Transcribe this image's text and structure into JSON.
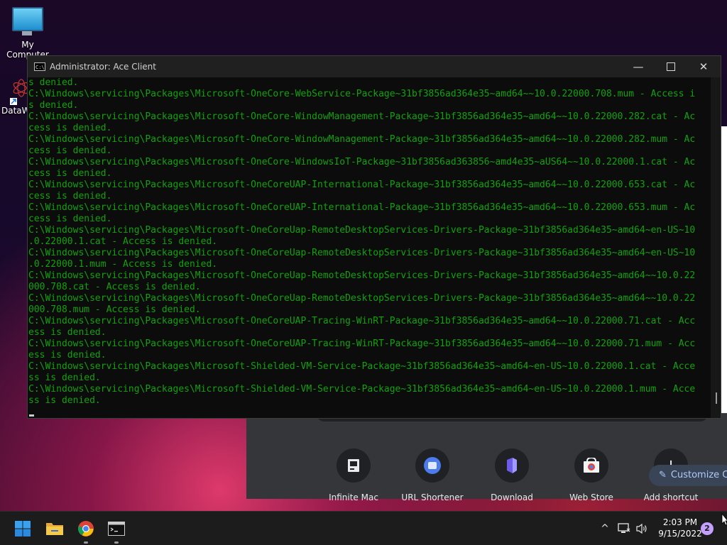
{
  "desktop": {
    "icons": [
      {
        "label": "My Computer",
        "icon": "monitor-icon"
      },
      {
        "label": "DataW",
        "icon": "datawrapper-shortcut-icon"
      }
    ]
  },
  "console_window": {
    "title": "Administrator:  Ace Client",
    "controls": [
      "minimize",
      "maximize",
      "close"
    ],
    "text_color": "#13a10e",
    "lines": [
      "s denied.",
      "C:\\Windows\\servicing\\Packages\\Microsoft-OneCore-WebService-Package~31bf3856ad364e35~amd64~~10.0.22000.708.mum - Access i",
      "s denied.",
      "C:\\Windows\\servicing\\Packages\\Microsoft-OneCore-WindowManagement-Package~31bf3856ad364e35~amd64~~10.0.22000.282.cat - Ac",
      "cess is denied.",
      "C:\\Windows\\servicing\\Packages\\Microsoft-OneCore-WindowManagement-Package~31bf3856ad364e35~amd64~~10.0.22000.282.mum - Ac",
      "cess is denied.",
      "C:\\Windows\\servicing\\Packages\\Microsoft-OneCore-WindowsIoT-Package~31bf3856ad363856~amd4e35~aUS64~~10.0.22000.1.cat - Ac",
      "cess is denied.",
      "C:\\Windows\\servicing\\Packages\\Microsoft-OneCoreUAP-International-Package~31bf3856ad364e35~amd64~~10.0.22000.653.cat - Ac",
      "cess is denied.",
      "C:\\Windows\\servicing\\Packages\\Microsoft-OneCoreUAP-International-Package~31bf3856ad364e35~amd64~~10.0.22000.653.mum - Ac",
      "cess is denied.",
      "C:\\Windows\\servicing\\Packages\\Microsoft-OneCoreUap-RemoteDesktopServices-Drivers-Package~31bf3856ad364e35~amd64~en-US~10",
      ".0.22000.1.cat - Access is denied.",
      "C:\\Windows\\servicing\\Packages\\Microsoft-OneCoreUap-RemoteDesktopServices-Drivers-Package~31bf3856ad364e35~amd64~en-US~10",
      ".0.22000.1.mum - Access is denied.",
      "C:\\Windows\\servicing\\Packages\\Microsoft-OneCoreUap-RemoteDesktopServices-Drivers-Package~31bf3856ad364e35~amd64~~10.0.22",
      "000.708.cat - Access is denied.",
      "C:\\Windows\\servicing\\Packages\\Microsoft-OneCoreUap-RemoteDesktopServices-Drivers-Package~31bf3856ad364e35~amd64~~10.0.22",
      "000.708.mum - Access is denied.",
      "C:\\Windows\\servicing\\Packages\\Microsoft-OneCoreUAP-Tracing-WinRT-Package~31bf3856ad364e35~amd64~~10.0.22000.71.cat - Acc",
      "ess is denied.",
      "C:\\Windows\\servicing\\Packages\\Microsoft-OneCoreUAP-Tracing-WinRT-Package~31bf3856ad364e35~amd64~~10.0.22000.71.mum - Acc",
      "ess is denied.",
      "C:\\Windows\\servicing\\Packages\\Microsoft-Shielded-VM-Service-Package~31bf3856ad364e35~amd64~en-US~10.0.22000.1.cat - Acce",
      "ss is denied.",
      "C:\\Windows\\servicing\\Packages\\Microsoft-Shielded-VM-Service-Package~31bf3856ad364e35~amd64~en-US~10.0.22000.1.mum - Acce",
      "ss is denied."
    ]
  },
  "browser_newtab": {
    "shortcuts": [
      {
        "label": "Infinite Mac",
        "icon": "infinite-mac-icon"
      },
      {
        "label": "URL Shortener",
        "icon": "url-shortener-icon"
      },
      {
        "label": "Download",
        "icon": "download-app-icon"
      },
      {
        "label": "Web Store",
        "icon": "web-store-icon"
      },
      {
        "label": "Add shortcut",
        "icon": "plus-icon"
      }
    ],
    "customize_label": "Customize C"
  },
  "taskbar": {
    "apps": [
      {
        "name": "start",
        "icon": "windows-start-icon"
      },
      {
        "name": "file-explorer",
        "icon": "folder-icon"
      },
      {
        "name": "chrome",
        "icon": "chrome-icon"
      },
      {
        "name": "terminal",
        "icon": "terminal-icon"
      }
    ],
    "tray": {
      "chevron": "^",
      "time": "2:03 PM",
      "date": "9/15/2022",
      "notification_count": "2"
    }
  }
}
